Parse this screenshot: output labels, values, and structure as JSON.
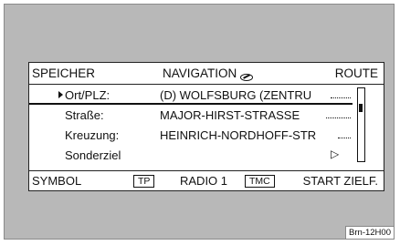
{
  "topbar": {
    "left_softkey": "SPEICHER",
    "title": "NAVIGATION",
    "title_icon": "satellite-nav-icon",
    "right_softkey": "ROUTE"
  },
  "rows": [
    {
      "label": "Ort/PLZ:",
      "value": "(D) WOLFSBURG (ZENTRU",
      "selected": true
    },
    {
      "label": "Straße:",
      "value": "MAJOR-HIRST-STRASSE",
      "selected": false
    },
    {
      "label": "Kreuzung:",
      "value": "HEINRICH-NORDHOFF-STR",
      "selected": false
    },
    {
      "label": "Sonderziel",
      "value": "",
      "selected": false
    }
  ],
  "bottombar": {
    "left_softkey": "SYMBOL",
    "tp_badge": "TP",
    "source": "RADIO 1",
    "tmc_badge": "TMC",
    "right_softkey": "START ZIELF."
  },
  "caption": "Brn-12H00"
}
